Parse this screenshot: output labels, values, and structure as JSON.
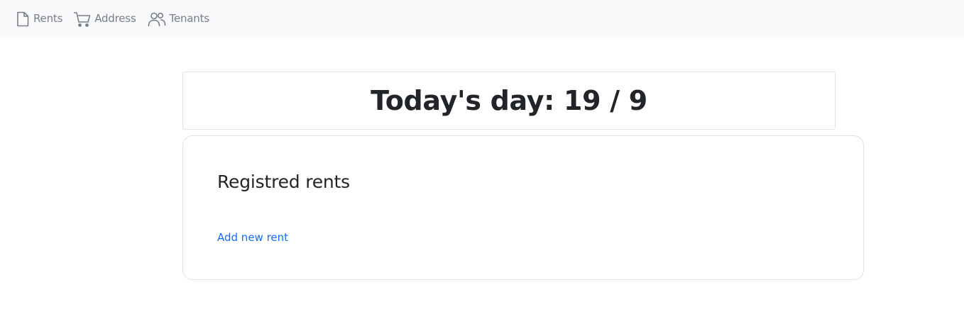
{
  "nav": {
    "items": [
      {
        "label": "Rents",
        "icon": "file-icon"
      },
      {
        "label": "Address",
        "icon": "cart-icon"
      },
      {
        "label": "Tenants",
        "icon": "people-icon"
      }
    ]
  },
  "day": {
    "title": "Today's day: 19 / 9"
  },
  "rents": {
    "heading": "Registred rents",
    "add_link": "Add new rent"
  },
  "colors": {
    "navbar_bg": "#f8f9fa",
    "nav_text": "#7a7f85",
    "link": "#0d6efd",
    "border": "#dee2e6",
    "text": "#212529"
  }
}
